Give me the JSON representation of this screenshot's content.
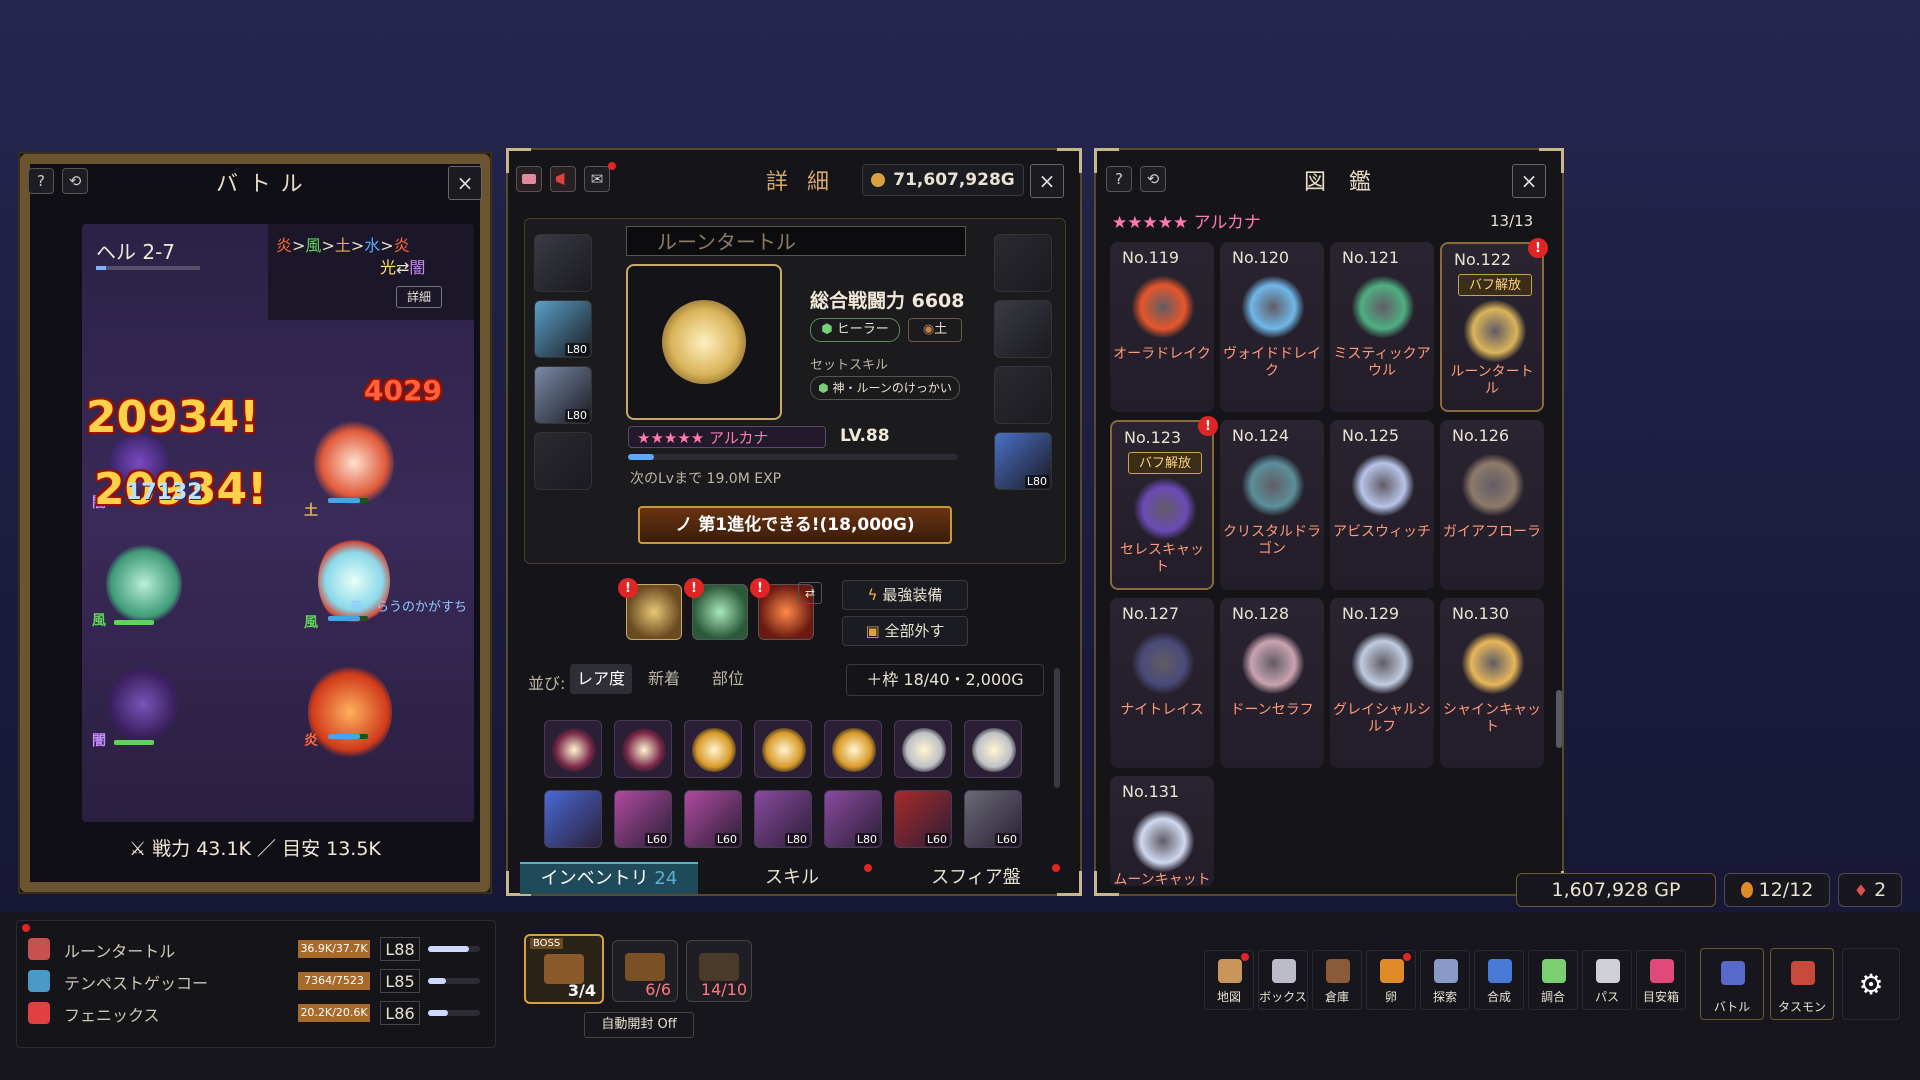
{
  "colors": {
    "gold": "#c8a35a",
    "panel": "#141419",
    "accent_red": "#e02525",
    "orange": "#ff9a7a"
  },
  "battle": {
    "title": "バトル",
    "help": "?",
    "refresh": "⟲",
    "close": "×",
    "stage": "ヘル 2-7",
    "element_cycle": {
      "f": "炎",
      "a1": ">",
      "w": "風",
      "a2": ">",
      "e": "土",
      "a3": ">",
      "wa": "水",
      "a4": ">",
      "f2": "炎",
      "lt": "光",
      "swap": "⇄",
      "dk": "闇"
    },
    "detail_btn": "詳細",
    "damage": {
      "d1": "20934!",
      "d2": "20934!",
      "d3": "4029",
      "d4": "17132"
    },
    "labels": {
      "dark": "闇",
      "earth": "土",
      "wind": "風",
      "wind2": "風",
      "dark2": "闇",
      "fire": "炎",
      "enemy_name": "竜・らうのかがすち"
    },
    "footer": "⚔ 戦力 43.1K ／ 目安 13.5K"
  },
  "party": [
    {
      "name": "ルーンタートル",
      "hp": "36.9K/37.7K",
      "lv": "L88",
      "fill": 0.78
    },
    {
      "name": "テンペストゲッコー",
      "hp": "7364/7523",
      "lv": "L85",
      "fill": 0.35
    },
    {
      "name": "フェニックス",
      "hp": "20.2K/20.6K",
      "lv": "L86",
      "fill": 0.38
    }
  ],
  "chests": {
    "boss": "BOSS",
    "c1": "3/4",
    "c2": "6/6",
    "c3": "14/10",
    "auto": "自動開封 Off"
  },
  "detail": {
    "title": "詳 細",
    "gold": "71,607,928G",
    "close": "×",
    "monster_name": "ルーンタートル",
    "power": "総合戦闘力 6608",
    "role": "ヒーラー",
    "element": "土",
    "set_skill_label": "セットスキル",
    "set_skill": "神・ルーンのけっかい",
    "rarity": "★★★★★ アルカナ",
    "level": "LV.88",
    "exp_fill": 0.08,
    "next_exp": "次のLvまで 19.0M EXP",
    "evolve": "ノ 第1進化できる!(18,000G)",
    "eq_left": [
      {
        "lv": ""
      },
      {
        "lv": "L80"
      },
      {
        "lv": "L80"
      },
      {
        "lv": ""
      }
    ],
    "eq_right": [
      {
        "lv": ""
      },
      {
        "lv": ""
      },
      {
        "lv": ""
      },
      {
        "lv": "L80"
      }
    ],
    "best_equip": "最強装備",
    "unequip_all": "全部外す",
    "sort_label": "並び:",
    "sort_tabs": [
      "レア度",
      "新着",
      "部位"
    ],
    "capacity": "＋枠 18/40・2,000G",
    "inventory_row1": [
      "",
      "",
      "",
      "",
      "",
      "",
      ""
    ],
    "inventory_row2": [
      "",
      "L60",
      "L60",
      "L80",
      "L80",
      "L60",
      "L60"
    ],
    "tabs": {
      "inventory": "インベントリ",
      "inv_count": "24",
      "skill": "スキル",
      "sphere": "スフィア盤"
    }
  },
  "dex": {
    "title": "図 鑑",
    "help": "?",
    "refresh": "⟲",
    "close": "×",
    "rarity": "★★★★★ アルカナ",
    "count": "13/13",
    "badge": "バフ解放",
    "cards": [
      {
        "no": "No.119",
        "name": "オーラドレイク",
        "color": "#e5562a"
      },
      {
        "no": "No.120",
        "name": "ヴォイドドレイク",
        "color": "#6fb7e8"
      },
      {
        "no": "No.121",
        "name": "ミスティックアウル",
        "color": "#4fae82"
      },
      {
        "no": "No.122",
        "name": "ルーンタートル",
        "color": "#d9b45a"
      },
      {
        "no": "No.123",
        "name": "セレスキャット",
        "color": "#6a4bb5"
      },
      {
        "no": "No.124",
        "name": "クリスタルドラゴン",
        "color": "#5b8f9a"
      },
      {
        "no": "No.125",
        "name": "アビスウィッチ",
        "color": "#b7c4e8"
      },
      {
        "no": "No.126",
        "name": "ガイアフローラ",
        "color": "#8d7a6a"
      },
      {
        "no": "No.127",
        "name": "ナイトレイス",
        "color": "#4a4a78"
      },
      {
        "no": "No.128",
        "name": "ドーンセラフ",
        "color": "#c9a3b0"
      },
      {
        "no": "No.129",
        "name": "グレイシャルシルフ",
        "color": "#c0cbe0"
      },
      {
        "no": "No.130",
        "name": "シャインキャット",
        "color": "#e8b65a"
      },
      {
        "no": "No.131",
        "name": "ムーンキャット",
        "color": "#d0d8f0"
      }
    ]
  },
  "currency": {
    "gp": "1,607,928 GP",
    "eggs": "12/12",
    "keys": "2"
  },
  "toolbar": [
    "地図",
    "ボックス",
    "倉庫",
    "卵",
    "探索",
    "合成",
    "調合",
    "パス",
    "目安箱",
    "バトル",
    "タスモン"
  ]
}
